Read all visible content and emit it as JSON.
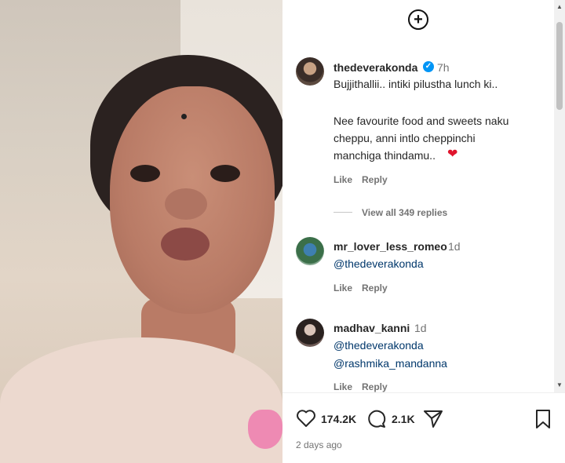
{
  "post": {
    "author": "thedeverakonda",
    "age": "7h",
    "caption_line1": "Bujjithallii.. intiki pilustha lunch ki..",
    "caption_line2": "Nee favourite food and sweets naku",
    "caption_line3": "cheppu, anni intlo cheppinchi",
    "caption_line4": "manchiga thindamu..",
    "caption_emoji": "❤",
    "like_label": "Like",
    "reply_label": "Reply",
    "view_replies": "View all 349 replies"
  },
  "comments": [
    {
      "user": "mr_lover_less_romeo",
      "age": "1d",
      "mentions": [
        "@thedeverakonda"
      ],
      "like_label": "Like",
      "reply_label": "Reply"
    },
    {
      "user": "madhav_kanni",
      "age": "1d",
      "mentions": [
        "@thedeverakonda",
        "@rashmika_mandanna"
      ],
      "like_label": "Like",
      "reply_label": "Reply"
    }
  ],
  "actions": {
    "likes": "174.2K",
    "comments": "2.1K",
    "posted": "2 days ago"
  },
  "icons": {
    "new_post": "plus-circle-icon",
    "like": "heart-icon",
    "comment": "speech-bubble-icon",
    "share": "paper-plane-icon",
    "save": "bookmark-icon",
    "verified": "verified-badge-icon"
  },
  "colors": {
    "link": "#00376b",
    "verified": "#0095f6",
    "muted": "#737373"
  }
}
